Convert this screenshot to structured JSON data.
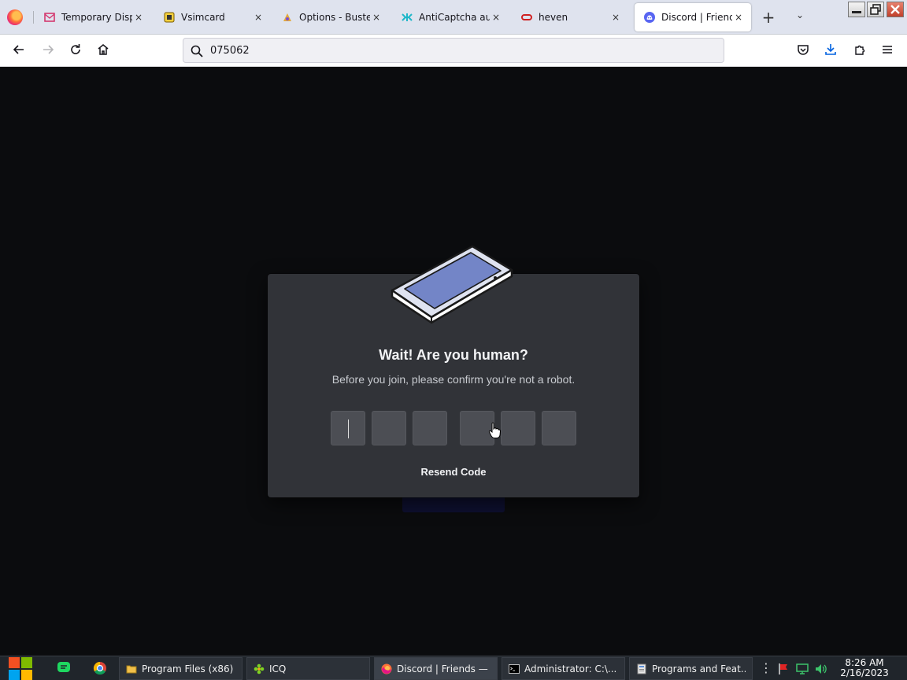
{
  "browser": {
    "tabs": [
      {
        "title": "Temporary Dispo",
        "favicon": "mail-icon",
        "color": "#d4386f"
      },
      {
        "title": "Vsimcard",
        "favicon": "sim-card-icon",
        "color": "#c7a01c"
      },
      {
        "title": "Options - Buster:",
        "favicon": "buster-icon",
        "color": "#e3a93b"
      },
      {
        "title": "AntiCaptcha auto",
        "favicon": "anticaptcha-icon",
        "color": "#1fb7c9"
      },
      {
        "title": "heven",
        "favicon": "link-icon",
        "color": "#d02020"
      },
      {
        "title": "Discord | Friends",
        "favicon": "discord-icon",
        "color": "#5865f2"
      }
    ],
    "close_glyph": "×",
    "new_tab_glyph": "+",
    "list_tabs_glyph": "⌄",
    "url": "075062"
  },
  "modal": {
    "title": "Wait! Are you human?",
    "subtitle": "Before you join, please confirm you're not a robot.",
    "resend_label": "Resend Code",
    "code_digits": [
      "",
      "",
      "",
      "",
      "",
      ""
    ]
  },
  "taskbar": {
    "buttons": [
      {
        "label": "Program Files (x86)",
        "icon": "folder-icon"
      },
      {
        "label": "ICQ",
        "icon": "icq-icon"
      },
      {
        "label": "Discord | Friends — ...",
        "icon": "firefox-icon"
      },
      {
        "label": "Administrator: C:\\...",
        "icon": "cmd-icon"
      },
      {
        "label": "Programs and Feat...",
        "icon": "programs-icon"
      }
    ],
    "time": "8:26 AM",
    "date": "2/16/2023"
  },
  "colors": {
    "modal_bg": "#313338",
    "code_box": "#4c4e54",
    "discord_blurple": "#5865f2"
  }
}
